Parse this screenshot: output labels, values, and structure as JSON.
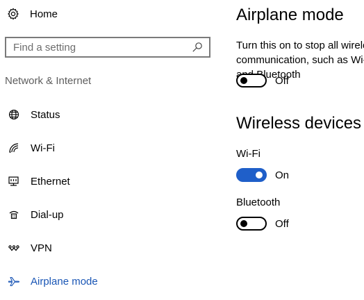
{
  "sidebar": {
    "home_label": "Home",
    "search": {
      "placeholder": "Find a setting",
      "value": ""
    },
    "section_heading": "Network & Internet",
    "items": [
      {
        "label": "Status",
        "icon": "globe-icon"
      },
      {
        "label": "Wi-Fi",
        "icon": "wifi-icon"
      },
      {
        "label": "Ethernet",
        "icon": "ethernet-icon"
      },
      {
        "label": "Dial-up",
        "icon": "dialup-icon"
      },
      {
        "label": "VPN",
        "icon": "vpn-icon"
      },
      {
        "label": "Airplane mode",
        "icon": "airplane-icon",
        "active": true
      }
    ]
  },
  "main": {
    "airplane": {
      "title": "Airplane mode",
      "description": "Turn this on to stop all wireless communication, such as Wi-Fi, cellular, and Bluetooth",
      "toggle": {
        "on": false,
        "state_label": "Off"
      }
    },
    "wireless": {
      "title": "Wireless devices",
      "wifi": {
        "label": "Wi-Fi",
        "on": true,
        "state_label": "On"
      },
      "bluetooth": {
        "label": "Bluetooth",
        "on": false,
        "state_label": "Off"
      }
    }
  },
  "colors": {
    "accent": "#1f5fc9",
    "active_nav_text": "#1a56b5",
    "section_heading": "#5d5d5d"
  }
}
